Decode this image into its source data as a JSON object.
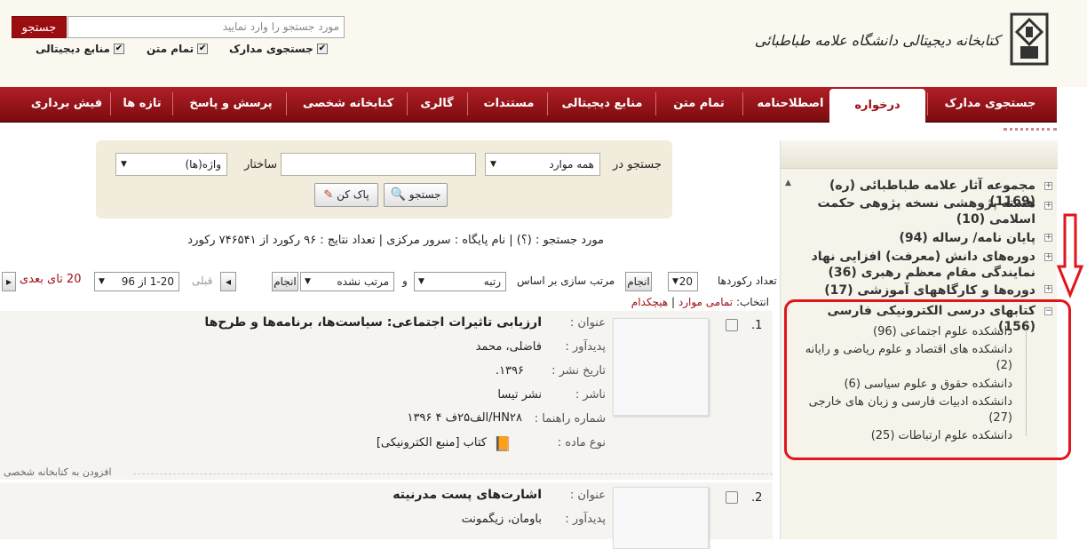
{
  "header": {
    "logo_text": "کتابخانه دیجیتالی دانشگاه علامه طباطبائی",
    "search_placeholder": "مورد جستجو را وارد نمایید",
    "search_button": "جستجو",
    "checks": [
      {
        "label": "جستجوی مدارک",
        "checked": true
      },
      {
        "label": "تمام متن",
        "checked": true
      },
      {
        "label": "منابع دیجیتالی",
        "checked": true
      }
    ]
  },
  "nav": {
    "items": [
      "جستجوی مدارک",
      "درخواره",
      "اصطلاحنامه",
      "تمام متن",
      "منابع دیجیتالی",
      "مستندات",
      "گالری",
      "کتابخانه شخصی",
      "پرسش و پاسخ",
      "تازه ها",
      "فیش برداری"
    ],
    "active": "درخواره"
  },
  "query_panel": {
    "search_in_label": "جستجو در",
    "search_in_value": "همه موارد",
    "structure_label": "ساختار",
    "term_value": "واژه(ها)",
    "search_button": "جستجو",
    "clear_button": "پاک کن"
  },
  "status": "مورد جستجو : (؟) | نام پایگاه : سرور مرکزی | تعداد نتایج : ۹۶ رکورد از ۷۴۶۵۴۱ رکورد",
  "controls": {
    "records_count_label": "تعداد رکوردها",
    "records_count_value": "20",
    "apply": "انجام",
    "sort_label": "مرتب سازی بر اساس",
    "sort_value": "رتبه",
    "and": "و",
    "order_value": "مرتب نشده",
    "prev": "قبلی",
    "range_value": "1-20 از 96",
    "next": "20 تای بعدی"
  },
  "select_line": {
    "label": "انتخاب:",
    "all": "تمامی موارد",
    "none": "هیچکدام"
  },
  "results": [
    {
      "num": "1.",
      "fields": [
        {
          "label": "عنوان :",
          "value": "ارزیابی تاثیرات اجتماعی: سیاست‌ها، برنامه‌ها و طرح‌ها"
        },
        {
          "label": "پدیدآور :",
          "value": "فاضلی، محمد"
        },
        {
          "label": "تاریخ نشر :",
          "value": "۱۳۹۶."
        },
        {
          "label": "ناشر :",
          "value": "نشر تیسا"
        },
        {
          "label": "شماره راهنما :",
          "value": "HN۲۸/الف۲۵ف ۴ ۱۳۹۶"
        },
        {
          "label": "نوع ماده :",
          "value": "کتاب [منبع الکترونیکی]"
        }
      ],
      "add_link": "افزودن به کتابخانه شخصی"
    },
    {
      "num": "2.",
      "fields": [
        {
          "label": "عنوان :",
          "value": "اشارت‌های پست مدرنیته"
        },
        {
          "label": "پدیدآور :",
          "value": "باومان، زیگمونت"
        }
      ]
    }
  ],
  "sidebar": {
    "nodes": [
      {
        "label": "مجموعه آثار علامه طباطبائی (ره) (1169)"
      },
      {
        "label": "هسته پژوهشی نسخه پژوهی حکمت اسلامی (10)"
      },
      {
        "label": "پایان نامه/ رساله (94)"
      },
      {
        "label": "دوره‌های دانش (معرفت) افزایی نهاد نمایندگی مقام معظم رهبری (36)"
      },
      {
        "label": "دوره‌ها و کارگاههای آموزشی (17)"
      },
      {
        "label": "کتابهای درسی الکترونیکی فارسی (156)"
      }
    ],
    "children": [
      "دانشکده علوم اجتماعی (96)",
      "دانشکده های اقتصاد و علوم ریاضی و رایانه (2)",
      "دانشکده حقوق و علوم سیاسی (6)",
      "دانشکده ادبیات فارسی و زبان های خارجی (27)",
      "دانشکده علوم ارتباطات (25)"
    ]
  },
  "colors": {
    "brand": "#9c0d12",
    "highlight": "#e2141c"
  }
}
